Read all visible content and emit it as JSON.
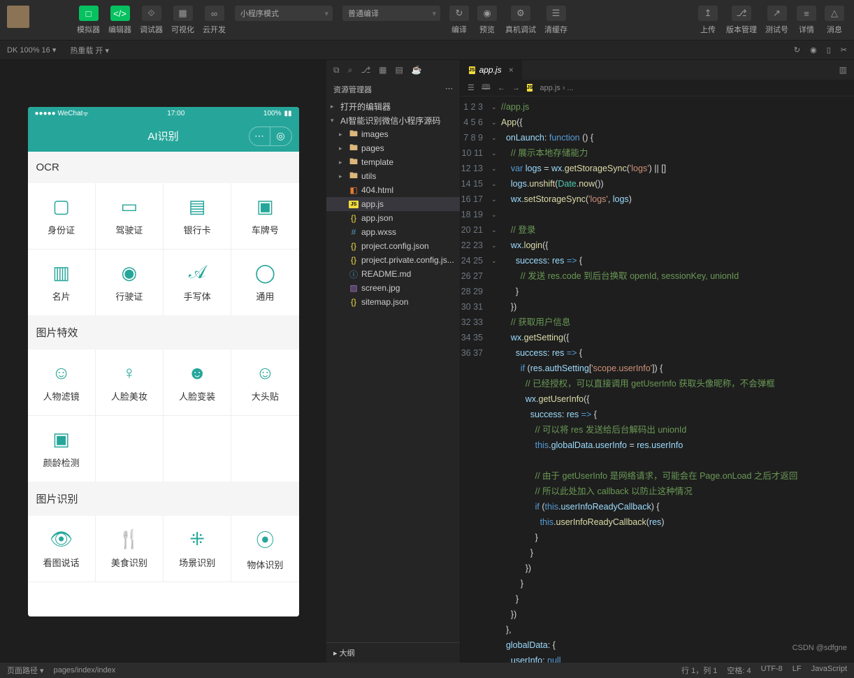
{
  "toolbar": {
    "simulator": "模拟器",
    "editor": "编辑器",
    "debugger": "调试器",
    "visualize": "可视化",
    "cloud": "云开发",
    "mode": "小程序模式",
    "compile_opt": "普通编译",
    "compile": "编译",
    "preview": "预览",
    "remote": "真机调试",
    "clear": "清缓存",
    "upload": "上传",
    "version": "版本管理",
    "test": "测试号",
    "detail": "详情",
    "message": "消息"
  },
  "subbar": {
    "left": "DK 100% 16 ▾",
    "hot": "热重载 开 ▾"
  },
  "phone": {
    "wechat": "●●●●● WeChat",
    "time": "17:00",
    "battery": "100%",
    "title": "AI识别",
    "sec1": "OCR",
    "sec2": "图片特效",
    "sec3": "图片识别",
    "ocr": [
      "身份证",
      "驾驶证",
      "银行卡",
      "车牌号",
      "名片",
      "行驶证",
      "手写体",
      "通用"
    ],
    "fx": [
      "人物滤镜",
      "人脸美妆",
      "人脸变装",
      "大头贴",
      "颜龄检测"
    ],
    "rec": [
      "看图说话",
      "美食识别",
      "场景识别",
      "物体识别"
    ]
  },
  "explorer": {
    "title": "资源管理器",
    "opened": "打开的编辑器",
    "project": "AI智能识别微信小程序源码",
    "folders": [
      "images",
      "pages",
      "template",
      "utils"
    ],
    "files": [
      {
        "n": "404.html",
        "t": "html"
      },
      {
        "n": "app.js",
        "t": "js",
        "sel": true
      },
      {
        "n": "app.json",
        "t": "json"
      },
      {
        "n": "app.wxss",
        "t": "css"
      },
      {
        "n": "project.config.json",
        "t": "json"
      },
      {
        "n": "project.private.config.js...",
        "t": "json"
      },
      {
        "n": "README.md",
        "t": "md"
      },
      {
        "n": "screen.jpg",
        "t": "img"
      },
      {
        "n": "sitemap.json",
        "t": "json"
      }
    ],
    "outline": "大纲"
  },
  "tab": {
    "name": "app.js"
  },
  "crumb": "app.js › ...",
  "code": [
    {
      "n": 1,
      "h": "<span class='c-cm'>//app.js</span>"
    },
    {
      "n": 2,
      "h": "<span class='c-fn'>App</span><span class='c-op'>({</span>"
    },
    {
      "n": 3,
      "h": "  <span class='c-prop'>onLaunch</span><span class='c-op'>:</span> <span class='c-kw'>function</span> <span class='c-op'>() {</span>"
    },
    {
      "n": 4,
      "h": "    <span class='c-cm'>// 展示本地存储能力</span>"
    },
    {
      "n": 5,
      "h": "    <span class='c-kw'>var</span> <span class='c-var'>logs</span> <span class='c-op'>=</span> <span class='c-var'>wx</span><span class='c-op'>.</span><span class='c-fn'>getStorageSync</span><span class='c-op'>(</span><span class='c-str'>'logs'</span><span class='c-op'>) || []</span>"
    },
    {
      "n": 6,
      "h": "    <span class='c-var'>logs</span><span class='c-op'>.</span><span class='c-fn'>unshift</span><span class='c-op'>(</span><span class='c-obj'>Date</span><span class='c-op'>.</span><span class='c-fn'>now</span><span class='c-op'>())</span>"
    },
    {
      "n": 7,
      "h": "    <span class='c-var'>wx</span><span class='c-op'>.</span><span class='c-fn'>setStorageSync</span><span class='c-op'>(</span><span class='c-str'>'logs'</span><span class='c-op'>,</span> <span class='c-var'>logs</span><span class='c-op'>)</span>"
    },
    {
      "n": 8,
      "h": ""
    },
    {
      "n": 9,
      "h": "    <span class='c-cm'>// 登录</span>"
    },
    {
      "n": 10,
      "h": "    <span class='c-var'>wx</span><span class='c-op'>.</span><span class='c-fn'>login</span><span class='c-op'>({</span>"
    },
    {
      "n": 11,
      "h": "      <span class='c-prop'>success</span><span class='c-op'>:</span> <span class='c-var'>res</span> <span class='c-kw'>=&gt;</span> <span class='c-op'>{</span>"
    },
    {
      "n": 12,
      "h": "        <span class='c-cm'>// 发送 res.code 到后台换取 openId, sessionKey, unionId</span>"
    },
    {
      "n": 13,
      "h": "      <span class='c-op'>}</span>"
    },
    {
      "n": 14,
      "h": "    <span class='c-op'>})</span>"
    },
    {
      "n": 15,
      "h": "    <span class='c-cm'>// 获取用户信息</span>"
    },
    {
      "n": 16,
      "h": "    <span class='c-var'>wx</span><span class='c-op'>.</span><span class='c-fn'>getSetting</span><span class='c-op'>({</span>"
    },
    {
      "n": 17,
      "h": "      <span class='c-prop'>success</span><span class='c-op'>:</span> <span class='c-var'>res</span> <span class='c-kw'>=&gt;</span> <span class='c-op'>{</span>"
    },
    {
      "n": 18,
      "h": "        <span class='c-kw'>if</span> <span class='c-op'>(</span><span class='c-var'>res</span><span class='c-op'>.</span><span class='c-var'>authSetting</span><span class='c-op'>[</span><span class='c-str'>'scope.userInfo'</span><span class='c-op'>]) {</span>"
    },
    {
      "n": 19,
      "h": "          <span class='c-cm'>// 已经授权，可以直接调用 getUserInfo 获取头像昵称，不会弹框</span>"
    },
    {
      "n": 20,
      "h": "          <span class='c-var'>wx</span><span class='c-op'>.</span><span class='c-fn'>getUserInfo</span><span class='c-op'>({</span>"
    },
    {
      "n": 21,
      "h": "            <span class='c-prop'>success</span><span class='c-op'>:</span> <span class='c-var'>res</span> <span class='c-kw'>=&gt;</span> <span class='c-op'>{</span>"
    },
    {
      "n": 22,
      "h": "              <span class='c-cm'>// 可以将 res 发送给后台解码出 unionId</span>"
    },
    {
      "n": 23,
      "h": "              <span class='c-kw'>this</span><span class='c-op'>.</span><span class='c-var'>globalData</span><span class='c-op'>.</span><span class='c-var'>userInfo</span> <span class='c-op'>=</span> <span class='c-var'>res</span><span class='c-op'>.</span><span class='c-var'>userInfo</span>"
    },
    {
      "n": 24,
      "h": ""
    },
    {
      "n": 25,
      "h": "              <span class='c-cm'>// 由于 getUserInfo 是网络请求，可能会在 Page.onLoad 之后才返回</span>"
    },
    {
      "n": 26,
      "h": "              <span class='c-cm'>// 所以此处加入 callback 以防止这种情况</span>"
    },
    {
      "n": 27,
      "h": "              <span class='c-kw'>if</span> <span class='c-op'>(</span><span class='c-kw'>this</span><span class='c-op'>.</span><span class='c-var'>userInfoReadyCallback</span><span class='c-op'>) {</span>"
    },
    {
      "n": 28,
      "h": "                <span class='c-kw'>this</span><span class='c-op'>.</span><span class='c-fn'>userInfoReadyCallback</span><span class='c-op'>(</span><span class='c-var'>res</span><span class='c-op'>)</span>"
    },
    {
      "n": 29,
      "h": "              <span class='c-op'>}</span>"
    },
    {
      "n": 30,
      "h": "            <span class='c-op'>}</span>"
    },
    {
      "n": 31,
      "h": "          <span class='c-op'>})</span>"
    },
    {
      "n": 32,
      "h": "        <span class='c-op'>}</span>"
    },
    {
      "n": 33,
      "h": "      <span class='c-op'>}</span>"
    },
    {
      "n": 34,
      "h": "    <span class='c-op'>})</span>"
    },
    {
      "n": 35,
      "h": "  <span class='c-op'>},</span>"
    },
    {
      "n": 36,
      "h": "  <span class='c-prop'>globalData</span><span class='c-op'>: {</span>"
    },
    {
      "n": 37,
      "h": "    <span class='c-prop'>userInfo</span><span class='c-op'>:</span> <span class='c-kw'>null</span>"
    }
  ],
  "status": {
    "path": "页面路径 ▾",
    "page": "pages/index/index",
    "pos": "行 1，列 1",
    "space": "空格: 4",
    "enc": "UTF-8",
    "eol": "LF",
    "lang": "JavaScript"
  },
  "watermark": "CSDN @sdfgne"
}
